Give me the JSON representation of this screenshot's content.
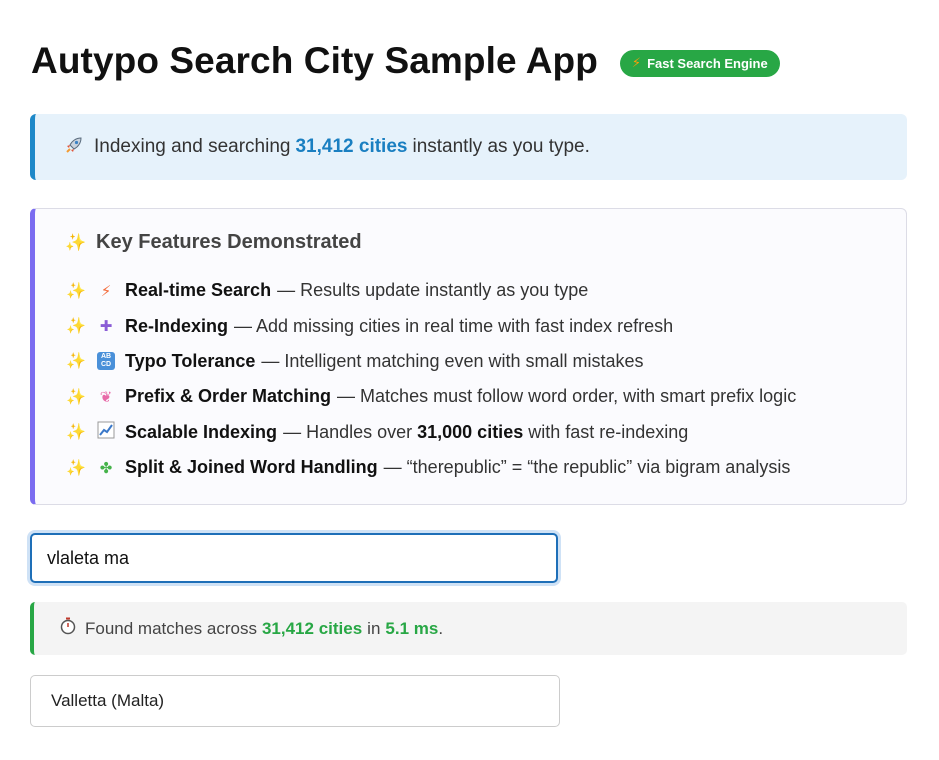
{
  "header": {
    "title": "Autypo Search City Sample App",
    "badge_icon": "⚡",
    "badge_label": "Fast Search Engine",
    "badge_color": "#28a745"
  },
  "info": {
    "icon": "rocket-icon",
    "prefix": "Indexing and searching",
    "highlight": "31,412 cities",
    "suffix": "instantly as you type."
  },
  "features": {
    "title": "Key Features Demonstrated",
    "items": [
      {
        "icon": "lightning-icon",
        "name": "Real-time Search",
        "desc": "— Results update instantly as you type"
      },
      {
        "icon": "plus-icon",
        "name": "Re-Indexing",
        "desc": "— Add missing cities in real time with fast index refresh"
      },
      {
        "icon": "abcd-icon",
        "name": "Typo Tolerance",
        "desc": "— Intelligent matching even with small mistakes"
      },
      {
        "icon": "brain-icon",
        "name": "Prefix & Order Matching",
        "desc": "— Matches must follow word order, with smart prefix logic"
      },
      {
        "icon": "chart-icon",
        "name": "Scalable Indexing",
        "desc": "— Handles over",
        "bold": "31,000 cities",
        "desc2": "with fast re-indexing"
      },
      {
        "icon": "puzzle-icon",
        "name": "Split & Joined Word Handling",
        "desc": "— “therepublic” = “the republic” via bigram analysis"
      }
    ]
  },
  "search": {
    "value": "vlaleta ma"
  },
  "stats": {
    "icon": "stopwatch-icon",
    "prefix": "Found matches across",
    "count": "31,412 cities",
    "middle": "in",
    "time": "5.1 ms",
    "suffix": "."
  },
  "results": [
    {
      "label": "Valletta (Malta)"
    }
  ]
}
